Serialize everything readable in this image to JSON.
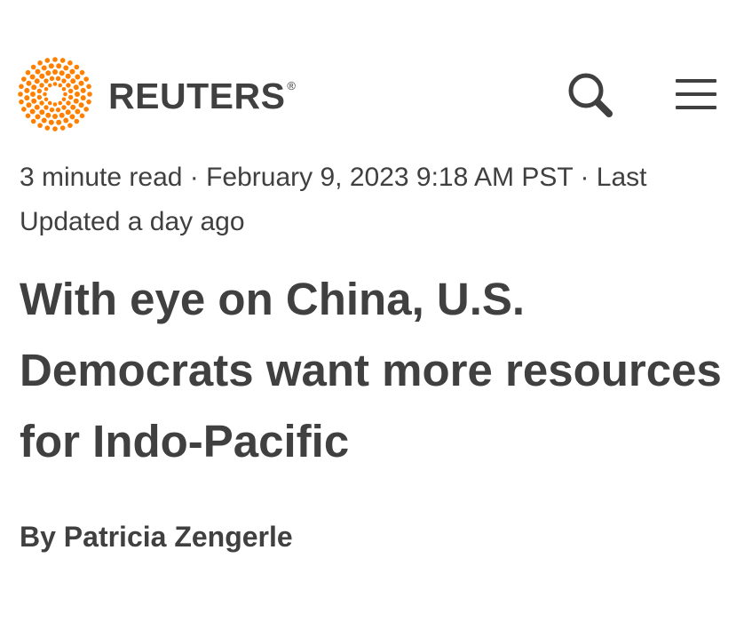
{
  "header": {
    "brand_name": "REUTERS",
    "registered_mark": "®",
    "logo_icon": "reuters-dot-logo-icon",
    "search_icon": "search-icon",
    "menu_icon": "hamburger-menu-icon",
    "brand_color": "#ff8000"
  },
  "article": {
    "meta_line": "3 minute read · February 9, 2023 9:18 AM PST · Last Updated a day ago",
    "headline": "With eye on China, U.S. Democrats want more resources for Indo-Pacific",
    "byline_prefix": "By",
    "author": "Patricia Zengerle"
  },
  "colors": {
    "text": "#404040",
    "background": "#ffffff",
    "accent": "#ff8000"
  }
}
